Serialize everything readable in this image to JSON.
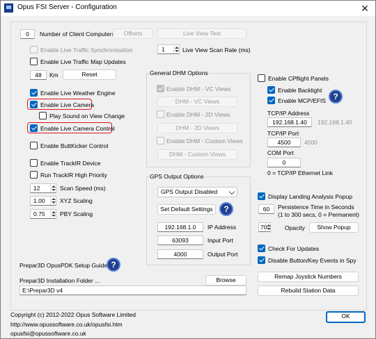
{
  "window": {
    "title": "Opus FSI Server - Configuration",
    "close_glyph": "✕"
  },
  "left": {
    "num_clients": {
      "value": "0",
      "label": "Number of Client Computers"
    },
    "offsets_label": "Offsets",
    "live_view_test_label": "Live View Test",
    "live_traffic_sync": "Enable Live Traffic Synchronisation",
    "live_traffic_map": "Enable Live Traffic Map Updates",
    "km": {
      "value": "48",
      "label": "Km"
    },
    "reset_label": "Reset",
    "live_weather": "Enable Live Weather Engine",
    "live_camera": "Enable Live Camera",
    "play_sound": "Play Sound on View Change",
    "live_camera_control": "Enable Live Camera Control",
    "buttkicker": "Enable ButtKicker Control",
    "trackir": "Enable TrackIR Device",
    "trackir_high": "Run TrackIR High Priority",
    "scan_speed": {
      "value": "12",
      "label": "Scan Speed (ms)"
    },
    "xyz": {
      "value": "1.00",
      "label": "XYZ Scaling"
    },
    "pby": {
      "value": "0.75",
      "label": "PBY Scaling"
    },
    "pdk_guide": "Prepar3D OpusPDK Setup Guide",
    "install_folder_label": "Prepar3D Installation Folder ...",
    "install_path": "E:\\Prepar3D v4",
    "browse_label": "Browse"
  },
  "middle": {
    "scan_rate": {
      "value": "1",
      "label": "Live View Scan Rate (ms)"
    },
    "dhm_title": "General DHM Options",
    "dhm_vc": "Enable DHM - VC Views",
    "dhm_vc_btn": "DHM - VC Views",
    "dhm_2d": "Enable DHM - 2D Views",
    "dhm_2d_btn": "DHM - 2D Views",
    "dhm_custom": "Enable DHM - Custom Views",
    "dhm_custom_btn": "DHM - Custom Views",
    "gps_title": "GPS Output Options",
    "gps_select": "GPS Output Disabled",
    "default_settings": "Set Default Settings",
    "ip": {
      "value": "192.168.1.0",
      "label": "IP Address"
    },
    "input_port": {
      "value": "63093",
      "label": "Input Port"
    },
    "output_port": {
      "value": "4000",
      "label": "Output Port"
    }
  },
  "right": {
    "cpflight": "Enable CPflight Panels",
    "backlight": "Enable Backlight",
    "mcp": "Enable MCP/EFIS",
    "tcp_ip_label": "TCP/IP Address",
    "tcp_ip": "192.168.1.40",
    "tcp_ip_default": "192.168.1.40",
    "tcp_port_label": "TCP/IP Port",
    "tcp_port": "4500",
    "tcp_port_default": "4500",
    "com_port_label": "COM Port",
    "com_port": "0",
    "com_note": "0 = TCP/IP Ethernet Link",
    "landing_popup": "Display Landing Analysis Popup",
    "persistence": {
      "value": "60",
      "line1": "Persistence Time in Seconds",
      "line2": "(1 to 300 secs, 0 = Permanent)"
    },
    "opacity": {
      "value": "70",
      "label": "Opacity"
    },
    "show_popup": "Show Popup",
    "check_updates": "Check For Updates",
    "disable_spy": "Disable Button/Key Events in Spy",
    "remap_joystick": "Remap Joystick Numbers",
    "rebuild_station": "Rebuild Station Data"
  },
  "footer": {
    "copyright": "Copyright (c)  2012-2022 Opus Software Limited",
    "url": "http://www.opussoftware.co.uk/opusfsi.htm",
    "email": "opusfsi@opussoftware.co.uk",
    "ok_label": "OK"
  },
  "colors": {
    "accent": "#0067c0",
    "highlight_box": "#d8141c",
    "help_icon": "#1f3f8c"
  }
}
